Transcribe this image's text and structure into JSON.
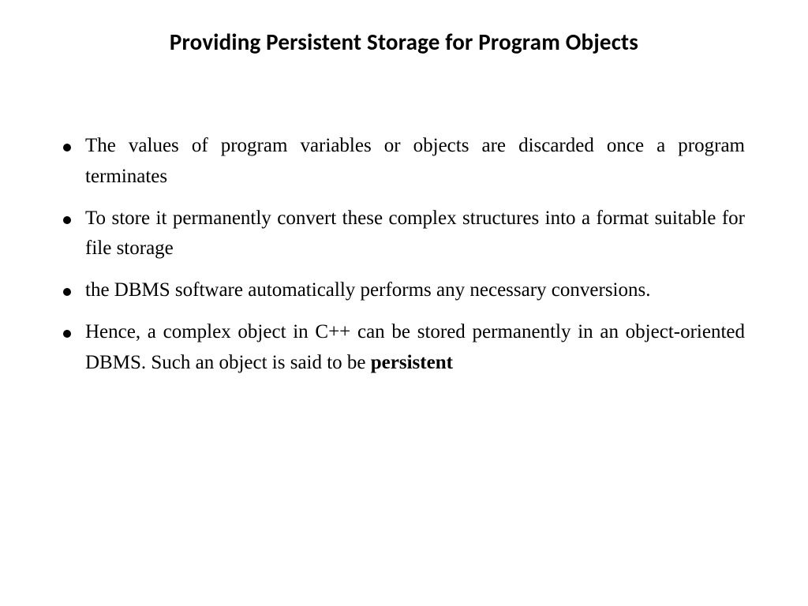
{
  "title": "Providing Persistent Storage for Program Objects",
  "bullets": {
    "b1": "The values of program variables or objects are discarded once a program terminates",
    "b2": "To store it  permanently convert these complex structures into a format suitable for file storage",
    "b3": "the DBMS software automatically performs any necessary conversions.",
    "b4_part1": " Hence, a complex object in C++ can be stored permanently in an object-oriented DBMS. Such an object is said to be ",
    "b4_bold": "persistent"
  }
}
